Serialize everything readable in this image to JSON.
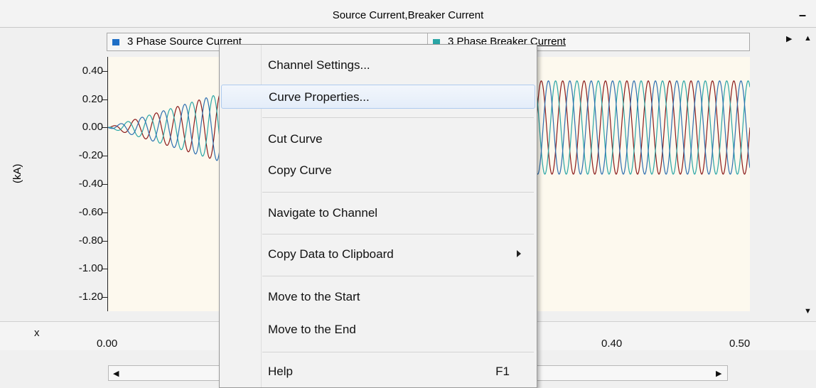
{
  "window": {
    "title": "Source Current,Breaker Current",
    "minimize_glyph": "–"
  },
  "legend": {
    "items": [
      {
        "label": "3 Phase Source Current",
        "color": "#1f6fc6"
      },
      {
        "label": "3 Phase Breaker Current",
        "color": "#2aa6a6"
      }
    ]
  },
  "chart_data": {
    "type": "line",
    "ylabel": "(kA)",
    "xlabel": "x",
    "yticks": [
      "0.40",
      "0.20",
      "0.00",
      "-0.20",
      "-0.40",
      "-0.60",
      "-0.80",
      "-1.00",
      "-1.20"
    ],
    "xticks": [
      "0.00",
      "0.40",
      "0.50"
    ],
    "ylim": [
      -1.3,
      0.5
    ],
    "xlim": [
      0.0,
      0.5
    ],
    "series": [
      {
        "color": "#8b1a1a",
        "amplitude_kA": 0.33,
        "phase_deg": 0
      },
      {
        "color": "#2aa6a6",
        "amplitude_kA": 0.33,
        "phase_deg": 120
      },
      {
        "color": "#2e6fb0",
        "amplitude_kA": 0.33,
        "phase_deg": 240
      }
    ],
    "frequency_hz": 60,
    "legend_position": "top"
  },
  "context_menu": {
    "items": [
      {
        "label": "Channel Settings...",
        "shortcut": "",
        "submenu": false
      },
      {
        "label": "Curve Properties...",
        "shortcut": "",
        "submenu": false,
        "highlighted": true
      },
      {
        "label": "Cut Curve",
        "shortcut": "",
        "submenu": false
      },
      {
        "label": "Copy Curve",
        "shortcut": "",
        "submenu": false
      },
      {
        "label": "Navigate to Channel",
        "shortcut": "",
        "submenu": false
      },
      {
        "label": "Copy Data to Clipboard",
        "shortcut": "",
        "submenu": true
      },
      {
        "label": "Move to the Start",
        "shortcut": "",
        "submenu": false
      },
      {
        "label": "Move to the End",
        "shortcut": "",
        "submenu": false
      },
      {
        "label": "Help",
        "shortcut": "F1",
        "submenu": false
      }
    ]
  },
  "scroll": {
    "left_arrow": "◀",
    "right_arrow": "▶",
    "up_arrow": "▲",
    "down_arrow": "▼"
  }
}
